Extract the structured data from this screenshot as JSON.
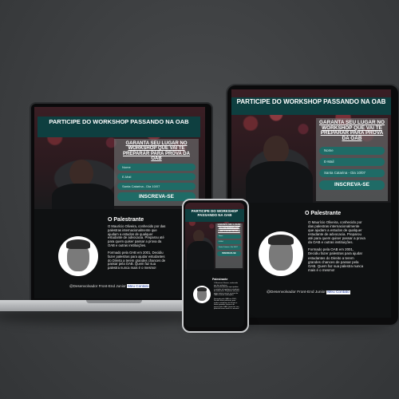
{
  "site": {
    "banner_title": "PARTICIPE DO WORKSHOP PASSANDO NA OAB",
    "form_title": "GARANTA SEU LUGAR NO WORKSHOP QUE VAI TE PREPARAR PARA PROVA DA OAB",
    "fields": {
      "name": "Nome",
      "email": "E-Mail",
      "date": "Santa Catarina - Dia 10/07"
    },
    "cta_label": "INSCREVA-SE",
    "speaker_heading": "O Palestrante",
    "bio_p1": "O Maurício Oliveira, conhecido por das palestras internacionalmente que ajudam a estudos de qualquer estudante de advocacia. Preparou até para quem quiser passar a prova da OAB e outras instituições.",
    "bio_p2": "Formado pela OAB em 2001, Decidiu fazer palestras para ajudar estudantes do Direito a terem grandes chances de passar pela OAB. Quem faz sua palestra nunca mais é o mesmo!",
    "footer_text": "@Desenvolvador Front-End Junior",
    "footer_link": "Meu Contato"
  },
  "phone": {
    "speaker_heading": "Palestrante"
  },
  "colors": {
    "banner": "#0e3f40",
    "field": "#1f6b66",
    "page_bg": "#0f1112"
  },
  "icons": {
    "avatar": "speaker-portrait-icon"
  }
}
